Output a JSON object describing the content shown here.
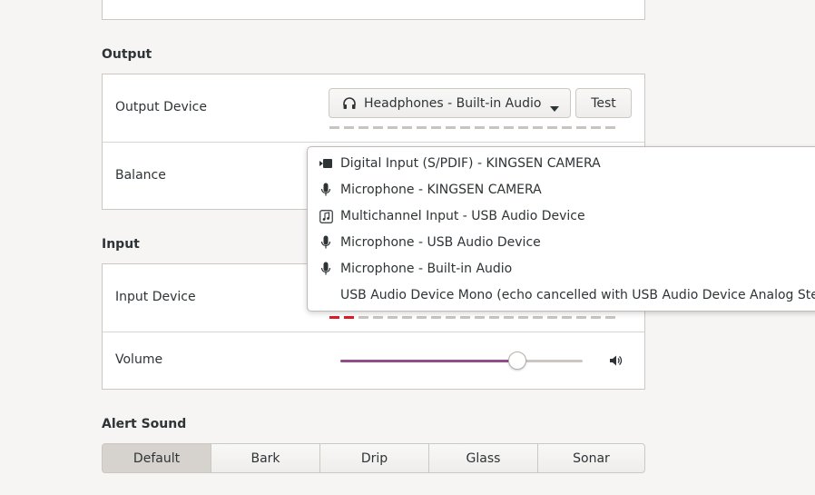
{
  "output": {
    "section_title": "Output",
    "device_label": "Output Device",
    "device_value": "Headphones - Built-in Audio",
    "test_button": "Test",
    "balance_label": "Balance"
  },
  "input": {
    "section_title": "Input",
    "device_label": "Input Device",
    "volume_label": "Volume",
    "volume_level": 0.73,
    "input_level_segments_on": 2
  },
  "popover": {
    "items": [
      {
        "icon": "video-camera-icon",
        "label": "Digital Input (S/PDIF) - KINGSEN CAMERA"
      },
      {
        "icon": "microphone-icon",
        "label": "Microphone - KINGSEN CAMERA"
      },
      {
        "icon": "music-note-icon",
        "label": "Multichannel Input - USB Audio Device"
      },
      {
        "icon": "microphone-icon",
        "label": "Microphone - USB Audio Device"
      },
      {
        "icon": "microphone-icon",
        "label": "Microphone - Built-in Audio"
      },
      {
        "icon": "none",
        "label": "USB Audio Device Mono (echo cancelled with USB Audio Device Analog Stereo)"
      }
    ]
  },
  "alert": {
    "section_title": "Alert Sound",
    "options": [
      "Default",
      "Bark",
      "Drip",
      "Glass",
      "Sonar"
    ],
    "selected": "Default"
  },
  "colors": {
    "accent": "#924d8b",
    "level_active": "#e01b24",
    "level_inactive": "#c8c4c0"
  }
}
